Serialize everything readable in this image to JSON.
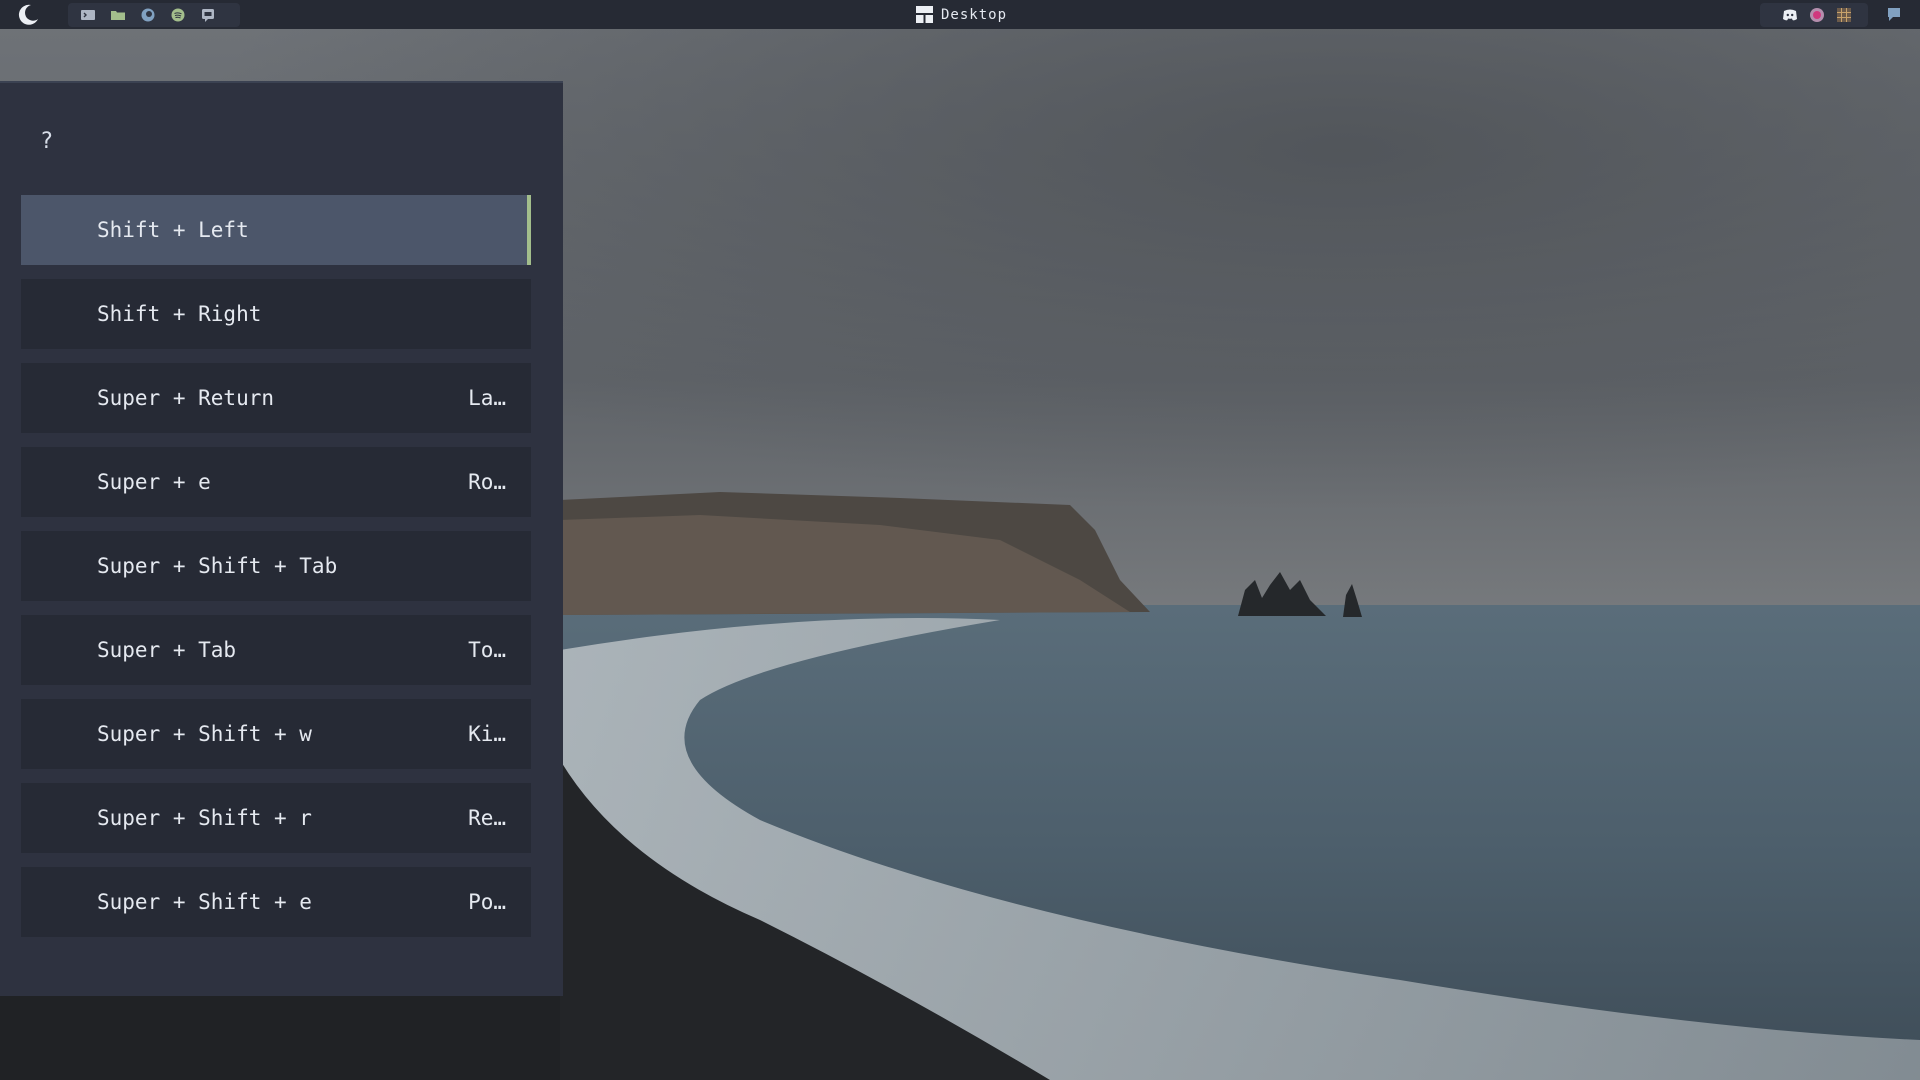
{
  "topbar": {
    "title": "Desktop",
    "launcher_icon": "moon-icon",
    "apps": [
      "terminal-icon",
      "folder-icon",
      "firefox-icon",
      "spotify-icon",
      "chat-icon"
    ],
    "tray": [
      "discord-icon",
      "color-picker-icon",
      "grid-icon"
    ],
    "notification_icon": "notification-icon"
  },
  "panel": {
    "prompt": "?",
    "entries": [
      {
        "key": "Shift + Left",
        "description": ""
      },
      {
        "key": "Shift + Right",
        "description": ""
      },
      {
        "key": "Super + Return",
        "description": "La…"
      },
      {
        "key": "Super + e",
        "description": "Ro…"
      },
      {
        "key": "Super + Shift + Tab",
        "description": ""
      },
      {
        "key": "Super + Tab",
        "description": "To…"
      },
      {
        "key": "Super + Shift + w",
        "description": "Ki…"
      },
      {
        "key": "Super + Shift + r",
        "description": "Re…"
      },
      {
        "key": "Super + Shift + e",
        "description": "Po…"
      }
    ],
    "selected_index": 0
  },
  "colors": {
    "bar_bg": "#262a34",
    "panel_bg": "#2e3240",
    "row_bg": "#262a35",
    "selected_bg": "#4c566a",
    "selected_accent": "#a3be8c",
    "text": "#e5e9f0"
  }
}
